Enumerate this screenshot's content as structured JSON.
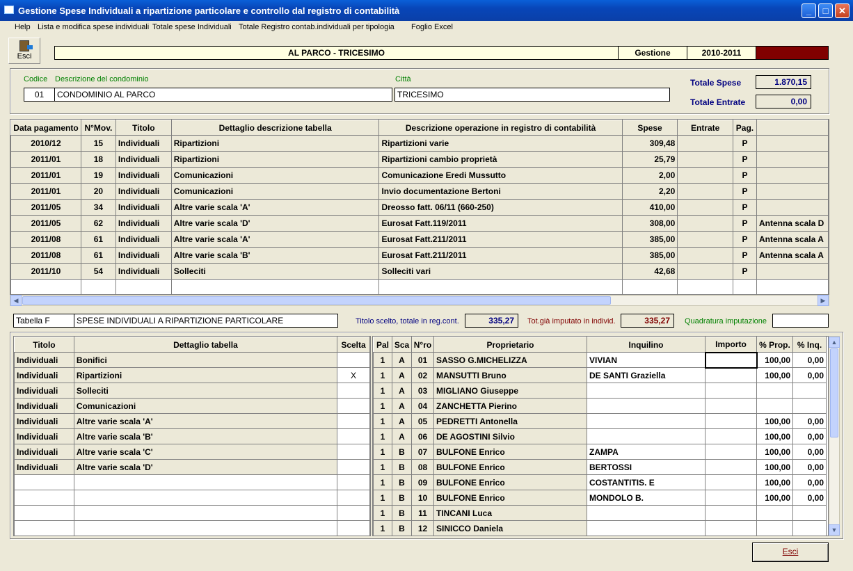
{
  "window": {
    "title": "Gestione Spese Individuali a ripartizione particolare e controllo dal registro di contabilità",
    "controls": [
      "_",
      "□",
      "✕"
    ]
  },
  "menu": [
    "Help",
    "Lista e modifica spese individuali",
    "Totale spese Individuali",
    "Totale Registro contab.individuali per tipologia",
    "Foglio Excel"
  ],
  "toolbar": {
    "esci_label": "Esci"
  },
  "header": {
    "condominio": "AL PARCO - TRICESIMO",
    "gestione_label": "Gestione",
    "gestione_value": "2010-2011"
  },
  "info": {
    "codice_label": "Codice",
    "descrizione_label": "Descrizione del condominio",
    "citta_label": "Città",
    "codice": "01",
    "descrizione": "CONDOMINIO AL PARCO",
    "citta": "TRICESIMO",
    "totale_spese_label": "Totale Spese",
    "totale_spese": "1.870,15",
    "totale_entrate_label": "Totale Entrate",
    "totale_entrate": "0,00"
  },
  "registro": {
    "columns": [
      "Data pagamento",
      "N°Mov.",
      "Titolo",
      "Dettaglio descrizione tabella",
      "Descrizione operazione in registro di contabilità",
      "Spese",
      "Entrate",
      "Pag.",
      ""
    ],
    "rows": [
      [
        "2010/12",
        "15",
        "Individuali",
        "Ripartizioni",
        "Ripartizioni varie",
        "309,48",
        "",
        "P",
        ""
      ],
      [
        "2011/01",
        "18",
        "Individuali",
        "Ripartizioni",
        "Ripartizioni cambio proprietà",
        "25,79",
        "",
        "P",
        ""
      ],
      [
        "2011/01",
        "19",
        "Individuali",
        "Comunicazioni",
        "Comunicazione Eredi Mussutto",
        "2,00",
        "",
        "P",
        ""
      ],
      [
        "2011/01",
        "20",
        "Individuali",
        "Comunicazioni",
        "Invio documentazione Bertoni",
        "2,20",
        "",
        "P",
        ""
      ],
      [
        "2011/05",
        "34",
        "Individuali",
        "Altre varie scala 'A'",
        "Dreosso fatt. 06/11 (660-250)",
        "410,00",
        "",
        "P",
        ""
      ],
      [
        "2011/05",
        "62",
        "Individuali",
        "Altre varie scala 'D'",
        "Eurosat Fatt.119/2011",
        "308,00",
        "",
        "P",
        "Antenna scala D"
      ],
      [
        "2011/08",
        "61",
        "Individuali",
        "Altre varie scala 'A'",
        "Eurosat Fatt.211/2011",
        "385,00",
        "",
        "P",
        "Antenna scala A"
      ],
      [
        "2011/08",
        "61",
        "Individuali",
        "Altre varie scala 'B'",
        "Eurosat Fatt.211/2011",
        "385,00",
        "",
        "P",
        "Antenna scala A"
      ],
      [
        "2011/10",
        "54",
        "Individuali",
        "Solleciti",
        "Solleciti vari",
        "42,68",
        "",
        "P",
        ""
      ],
      [
        "",
        "",
        "",
        "",
        "",
        "",
        "",
        "",
        ""
      ]
    ]
  },
  "tabella": {
    "label": "Tabella F",
    "name": "SPESE INDIVIDUALI A RIPARTIZIONE PARTICOLARE",
    "titolo_totale_label": "Titolo scelto, totale in reg.cont.",
    "titolo_totale": "335,27",
    "imputato_label": "Tot.già imputato in individ.",
    "imputato": "335,27",
    "quadratura_label": "Quadratura imputazione",
    "quadratura": ""
  },
  "titoli": {
    "columns": [
      "Titolo",
      "Dettaglio tabella",
      "Scelta"
    ],
    "rows": [
      [
        "Individuali",
        "Bonifici",
        ""
      ],
      [
        "Individuali",
        "Ripartizioni",
        "X"
      ],
      [
        "Individuali",
        "Solleciti",
        ""
      ],
      [
        "Individuali",
        "Comunicazioni",
        ""
      ],
      [
        "Individuali",
        "Altre varie scala 'A'",
        ""
      ],
      [
        "Individuali",
        "Altre varie scala 'B'",
        ""
      ],
      [
        "Individuali",
        "Altre varie scala 'C'",
        ""
      ],
      [
        "Individuali",
        "Altre varie scala 'D'",
        ""
      ],
      [
        "",
        "",
        ""
      ],
      [
        "",
        "",
        ""
      ],
      [
        "",
        "",
        ""
      ],
      [
        "",
        "",
        ""
      ]
    ]
  },
  "proprietari": {
    "columns": [
      "Pal",
      "Sca",
      "N°ro",
      "Proprietario",
      "Inquilino",
      "Importo",
      "% Prop.",
      "% Inq."
    ],
    "rows": [
      [
        "1",
        "A",
        "01",
        "SASSO G.MICHELIZZA",
        "VIVIAN",
        "",
        "100,00",
        "0,00"
      ],
      [
        "1",
        "A",
        "02",
        "MANSUTTI Bruno",
        "DE SANTI Graziella",
        "",
        "100,00",
        "0,00"
      ],
      [
        "1",
        "A",
        "03",
        "MIGLIANO Giuseppe",
        "",
        "",
        "",
        ""
      ],
      [
        "1",
        "A",
        "04",
        "ZANCHETTA Pierino",
        "",
        "",
        "",
        ""
      ],
      [
        "1",
        "A",
        "05",
        "PEDRETTI Antonella",
        "",
        "",
        "100,00",
        "0,00"
      ],
      [
        "1",
        "A",
        "06",
        "DE AGOSTINI Silvio",
        "",
        "",
        "100,00",
        "0,00"
      ],
      [
        "1",
        "B",
        "07",
        "BULFONE Enrico",
        "ZAMPA",
        "",
        "100,00",
        "0,00"
      ],
      [
        "1",
        "B",
        "08",
        "BULFONE Enrico",
        "BERTOSSI",
        "",
        "100,00",
        "0,00"
      ],
      [
        "1",
        "B",
        "09",
        "BULFONE Enrico",
        "COSTANTITIS. E",
        "",
        "100,00",
        "0,00"
      ],
      [
        "1",
        "B",
        "10",
        "BULFONE Enrico",
        "MONDOLO B.",
        "",
        "100,00",
        "0,00"
      ],
      [
        "1",
        "B",
        "11",
        "TINCANI Luca",
        "",
        "",
        "",
        ""
      ],
      [
        "1",
        "B",
        "12",
        "SINICCO Daniela",
        "",
        "",
        "",
        ""
      ]
    ]
  },
  "footer": {
    "esci_label": "Esci"
  },
  "colors": {
    "titlebar": "#0a4fc8",
    "form_bg": "#ece9d8",
    "highlight_bg": "#ffffe1",
    "dark_red": "#800000",
    "navy": "#000080",
    "green": "#008000"
  },
  "icons": {
    "esci": "exit-door-icon",
    "scroll_left": "arrow-left-icon",
    "scroll_right": "arrow-right-icon",
    "scroll_up": "arrow-up-icon",
    "scroll_down": "arrow-down-icon"
  }
}
